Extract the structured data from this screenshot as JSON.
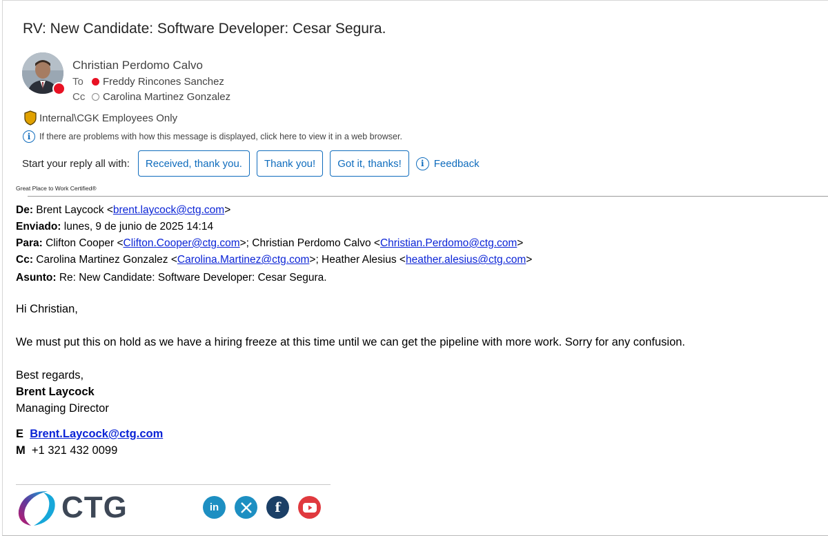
{
  "subject": "RV: New Candidate: Software Developer: Cesar Segura.",
  "sender": {
    "name": "Christian Perdomo Calvo"
  },
  "recipients": {
    "to_label": "To",
    "to": "Freddy Rincones Sanchez",
    "cc_label": "Cc",
    "cc": "Carolina Martinez Gonzalez"
  },
  "sensitivity": "Internal\\CGK Employees Only",
  "info_message": "If there are problems with how this message is displayed, click here to view it in a web browser.",
  "quick_reply": {
    "label": "Start your reply all with:",
    "options": [
      "Received, thank you.",
      "Thank you!",
      "Got it, thanks!"
    ],
    "feedback": "Feedback"
  },
  "gptw": "Great Place to Work Certified®",
  "forwarded": {
    "from_label": "De:",
    "from_name": "Brent Laycock <",
    "from_email": "brent.laycock@ctg.com",
    "sent_label": "Enviado:",
    "sent_value": "lunes, 9 de junio de 2025 14:14",
    "to_label": "Para:",
    "to_name1": "Clifton Cooper <",
    "to_email1": "Clifton.Cooper@ctg.com",
    "to_name2": ">; Christian Perdomo Calvo <",
    "to_email2": "Christian.Perdomo@ctg.com",
    "cc_label": "Cc:",
    "cc_name1": "Carolina Martinez Gonzalez <",
    "cc_email1": "Carolina.Martinez@ctg.com",
    "cc_name2": ">; Heather Alesius <",
    "cc_email2": "heather.alesius@ctg.com",
    "subject_label": "Asunto:",
    "subject_value": "Re: New Candidate: Software Developer: Cesar Segura."
  },
  "body": {
    "greeting": "Hi Christian,",
    "paragraph": "We must put this on hold as we have a hiring freeze at this time until we can get the pipeline with more work. Sorry for any confusion.",
    "closing": "Best regards,"
  },
  "signature": {
    "name": "Brent Laycock",
    "title": "Managing Director",
    "email_label": "E",
    "email": "Brent.Laycock@ctg.com",
    "phone_label": "M",
    "phone": "+1 321 432 0099",
    "logo_text": "CTG"
  },
  "social_icons": [
    "linkedin-icon",
    "x-twitter-icon",
    "facebook-icon",
    "youtube-icon"
  ],
  "colors": {
    "accent": "#0f6cbd",
    "busy": "#e81123",
    "link": "#0b24d6",
    "linkedin": "#1d8fc2",
    "x": "#1d8fc2",
    "facebook": "#1b3f66",
    "youtube": "#e0393e"
  }
}
